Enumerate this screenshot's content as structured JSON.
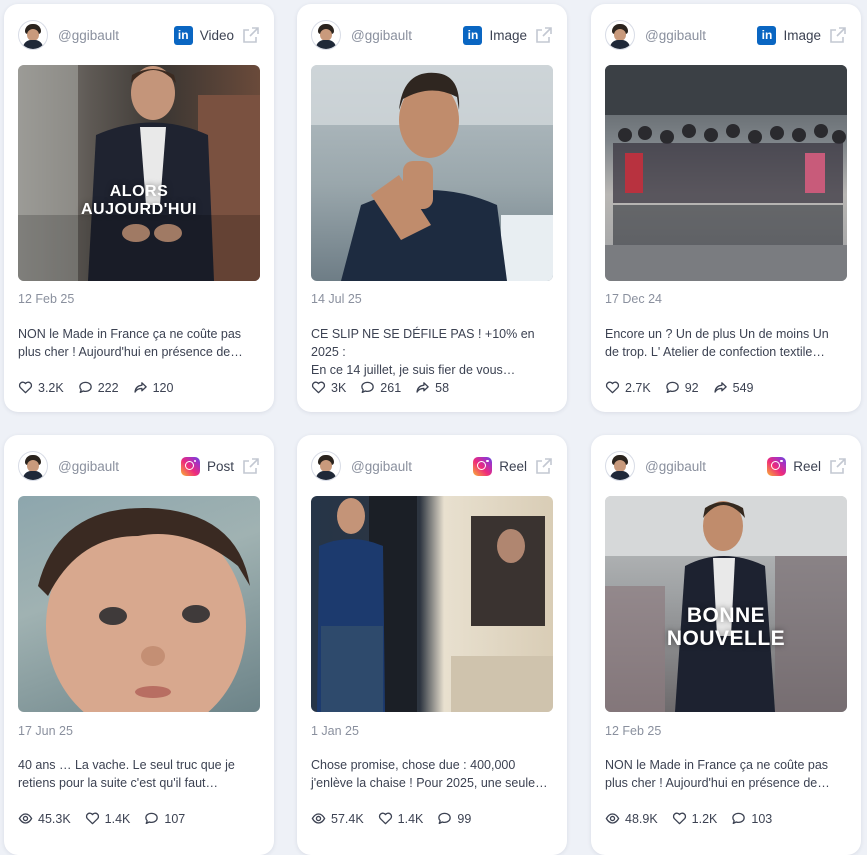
{
  "posts": [
    {
      "handle": "@ggibault",
      "platform": "linkedin",
      "type": "Video",
      "overlay": "ALORS\nAUJOURD'HUI",
      "date": "12 Feb 25",
      "caption_1": "NON le Made in France ça ne coûte pas",
      "caption_2": "plus cher ! Aujourd'hui en présence de…",
      "stats": [
        {
          "icon": "heart-icon",
          "value": "3.2K"
        },
        {
          "icon": "comment-icon",
          "value": "222"
        },
        {
          "icon": "share-icon",
          "value": "120"
        }
      ]
    },
    {
      "handle": "@ggibault",
      "platform": "linkedin",
      "type": "Image",
      "overlay": "",
      "date": "14 Jul 25",
      "caption_1": "CE SLIP NE SE DÉFILE PAS ! +10% en 2025 :",
      "caption_2": "En ce 14 juillet, je suis fier de vous…",
      "stats": [
        {
          "icon": "heart-icon",
          "value": "3K"
        },
        {
          "icon": "comment-icon",
          "value": "261"
        },
        {
          "icon": "share-icon",
          "value": "58"
        }
      ]
    },
    {
      "handle": "@ggibault",
      "platform": "linkedin",
      "type": "Image",
      "overlay": "",
      "date": "17 Dec 24",
      "caption_1": "Encore un ? Un de plus Un de moins Un",
      "caption_2": "de trop. L' Atelier de confection textile…",
      "stats": [
        {
          "icon": "heart-icon",
          "value": "2.7K"
        },
        {
          "icon": "comment-icon",
          "value": "92"
        },
        {
          "icon": "share-icon",
          "value": "549"
        }
      ]
    },
    {
      "handle": "@ggibault",
      "platform": "instagram",
      "type": "Post",
      "overlay": "",
      "date": "17 Jun 25",
      "caption_1": "40 ans … La vache. Le seul truc que je",
      "caption_2": "retiens pour la suite c'est qu'il faut…",
      "stats": [
        {
          "icon": "eye-icon",
          "value": "45.3K"
        },
        {
          "icon": "heart-icon",
          "value": "1.4K"
        },
        {
          "icon": "comment-icon",
          "value": "107"
        }
      ]
    },
    {
      "handle": "@ggibault",
      "platform": "instagram",
      "type": "Reel",
      "overlay": "",
      "date": "1 Jan 25",
      "caption_1": "Chose promise, chose due : 400,000",
      "caption_2": "j'enlève la chaise ! Pour 2025, une seule…",
      "stats": [
        {
          "icon": "eye-icon",
          "value": "57.4K"
        },
        {
          "icon": "heart-icon",
          "value": "1.4K"
        },
        {
          "icon": "comment-icon",
          "value": "99"
        }
      ]
    },
    {
      "handle": "@ggibault",
      "platform": "instagram",
      "type": "Reel",
      "overlay": "BONNE\nNOUVELLE",
      "date": "12 Feb 25",
      "caption_1": "NON le Made in France ça ne coûte pas",
      "caption_2": "plus cher ! Aujourd'hui en présence de…",
      "stats": [
        {
          "icon": "eye-icon",
          "value": "48.9K"
        },
        {
          "icon": "heart-icon",
          "value": "1.2K"
        },
        {
          "icon": "comment-icon",
          "value": "103"
        }
      ]
    }
  ],
  "icons": {
    "linkedin_letters": "in"
  },
  "colors": {
    "linkedin": "#0a66c2",
    "text_muted": "#8a909e"
  }
}
